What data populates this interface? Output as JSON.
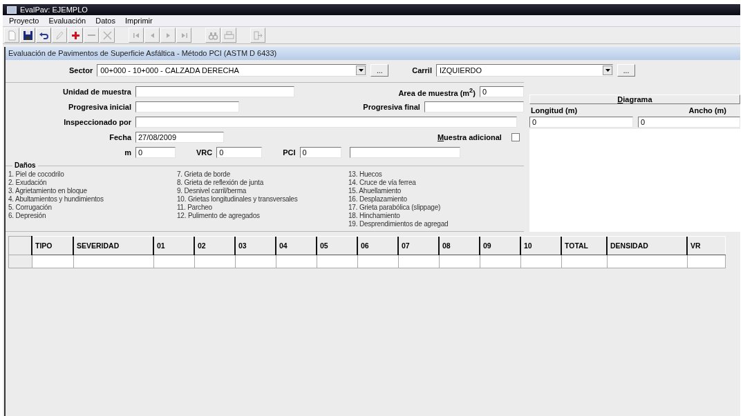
{
  "window": {
    "title": "EvalPav: EJEMPLO"
  },
  "menu": [
    "Proyecto",
    "Evaluación",
    "Datos",
    "Imprimir"
  ],
  "toolbar": [
    {
      "kind": "new",
      "disabled": true
    },
    {
      "kind": "save",
      "disabled": false
    },
    {
      "kind": "undo",
      "disabled": false
    },
    {
      "kind": "edit",
      "disabled": true
    },
    {
      "kind": "add",
      "disabled": false
    },
    {
      "kind": "remove",
      "disabled": true
    },
    {
      "kind": "delete",
      "disabled": true
    },
    {
      "kind": "sep"
    },
    {
      "kind": "first",
      "disabled": true
    },
    {
      "kind": "prev",
      "disabled": true
    },
    {
      "kind": "next",
      "disabled": true
    },
    {
      "kind": "last",
      "disabled": true
    },
    {
      "kind": "sep"
    },
    {
      "kind": "find",
      "disabled": true
    },
    {
      "kind": "print",
      "disabled": true
    },
    {
      "kind": "sep"
    },
    {
      "kind": "exit",
      "disabled": true
    }
  ],
  "form_title": "Evaluación de Pavimentos de Superficie Asfáltica - Método PCI (ASTM D 6433)",
  "sector": {
    "label": "Sector",
    "value": "00+000 - 10+000 - CALZADA DERECHA",
    "button": "..."
  },
  "carril": {
    "label": "Carril",
    "value": "IZQUIERDO",
    "button": "..."
  },
  "fields": [
    [
      {
        "label": "Unidad de muestra"
      },
      {
        "label": "Area de muestra (m$^{2}$)",
        "value": "0"
      }
    ],
    [
      {
        "label": "Progresiva inicial"
      },
      {
        "label": "Progresiva final"
      }
    ],
    [
      {
        "label": "Inspeccionado por"
      }
    ],
    [
      {
        "label": "Fecha",
        "value": "27/08/2009"
      },
      {
        "label": "Muestra adicional",
        "kind": "checkbox",
        "checked": false
      }
    ],
    [
      {
        "label": "m",
        "value": "0"
      },
      {
        "label": "VRC",
        "value": "0"
      },
      {
        "label": "PCI",
        "value": "0"
      },
      {
        "kind": "text"
      }
    ]
  ],
  "diagram": {
    "title": "Diagrama",
    "longitud_label": "Longitud (m)",
    "ancho_label": "Ancho (m)",
    "longitud": "0",
    "ancho": "0"
  },
  "danos": {
    "title": "Daños",
    "columns": [
      [
        "1. Piel de cocodrilo",
        "2. Exudación",
        "3. Agrietamiento en bloque",
        "4. Abultamientos y hundimientos",
        "5. Corrugación",
        "6. Depresión"
      ],
      [
        "7. Grieta de borde",
        "8. Grieta de reflexión de junta",
        "9. Desnivel carril/berma",
        "10. Grietas longitudinales y transversales",
        "11. Parcheo",
        "12. Pulimento de agregados"
      ],
      [
        "13. Huecos",
        "14. Cruce de vía ferrea",
        "15. Ahuellamiento",
        "16. Desplazamiento",
        "17. Grieta parabólica (slippage)",
        "18. Hinchamiento",
        "19. Desprendimientos de agregad"
      ]
    ]
  },
  "table": {
    "columns": [
      "TIPO",
      "SEVERIDAD",
      "01",
      "02",
      "03",
      "04",
      "05",
      "06",
      "07",
      "08",
      "09",
      "10",
      "TOTAL",
      "DENSIDAD",
      "VR"
    ]
  }
}
